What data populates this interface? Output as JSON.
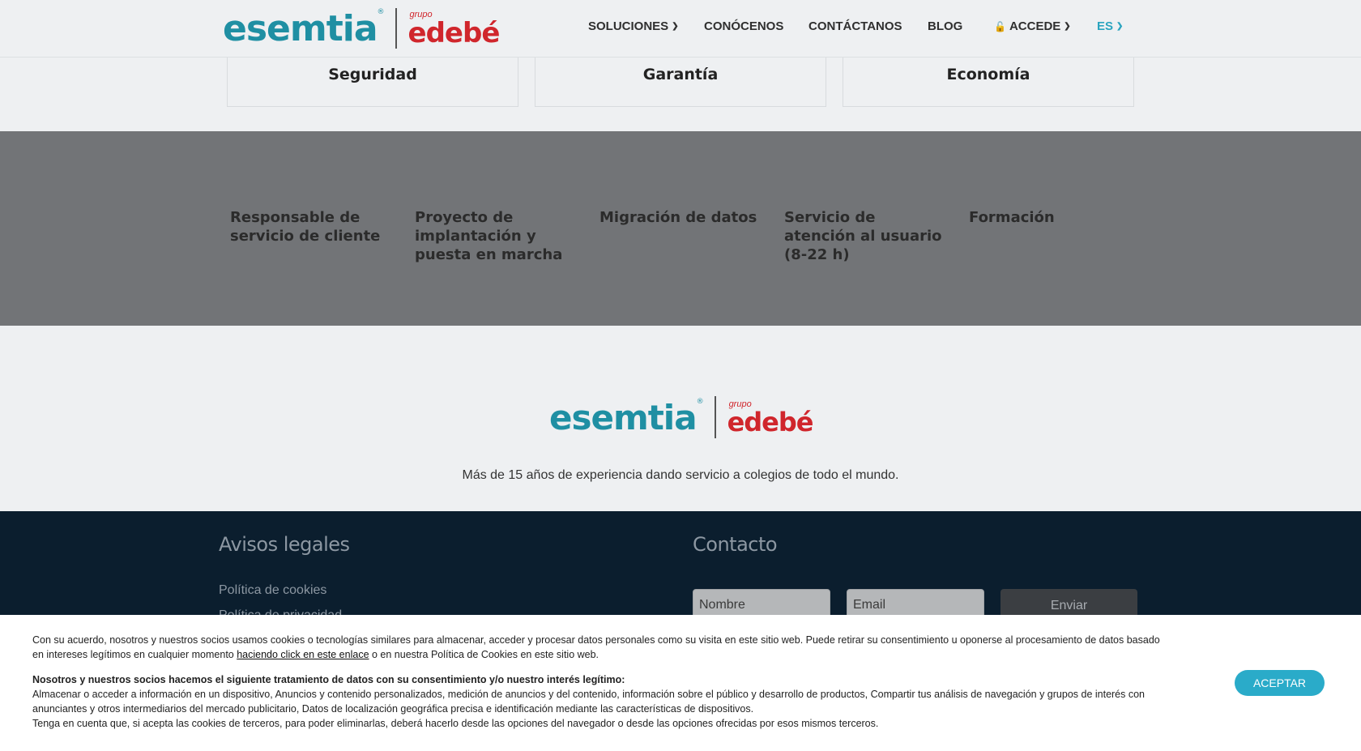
{
  "brand": {
    "name": "esemtia",
    "registered": "®",
    "group_prefix": "grupo",
    "group_name": "edebé",
    "primary_color": "#1f8fa3",
    "group_color": "#d0262c"
  },
  "nav": {
    "soluciones": "SOLUCIONES",
    "conocenos": "CONÓCENOS",
    "contactanos": "CONTÁCTANOS",
    "blog": "BLOG",
    "accede": "ACCEDE",
    "language": "ES",
    "chevron_icon": "chevron-down-icon",
    "lock_icon": "lock-icon"
  },
  "features": [
    "Seguridad",
    "Garantía",
    "Economía"
  ],
  "services": [
    "Responsable de servicio de cliente",
    "Proyecto de implantación y puesta en marcha",
    "Migración de datos",
    "Servicio de atención al usuario (8-22 h)",
    "Formación"
  ],
  "about": {
    "text": "Más de 15 años de experiencia dando servicio a colegios de todo el mundo."
  },
  "footer": {
    "legal_heading": "Avisos legales",
    "legal_links": [
      "Política de cookies",
      "Política de privacidad"
    ],
    "contact_heading": "Contacto",
    "name_placeholder": "Nombre",
    "email_placeholder": "Email",
    "send_label": "Enviar"
  },
  "cookie_banner": {
    "intro_before_link": "Con su acuerdo, nosotros y nuestros socios usamos cookies o tecnologías similares para almacenar, acceder y procesar datos personales como su visita en este sitio web. Puede retirar su consentimiento u oponerse al procesamiento de datos basado en intereses legítimos en cualquier momento ",
    "link_text": "haciendo click en este enlace",
    "intro_after_link": " o en nuestra Política de Cookies en este sitio web.",
    "purposes_heading": "Nosotros y nuestros socios hacemos el siguiente tratamiento de datos con su consentimiento y/o nuestro interés legítimo:",
    "purposes": "Almacenar o acceder a información en un dispositivo, Anuncios y contenido personalizados, medición de anuncios y del contenido, información sobre el público y desarrollo de productos, Compartir tus análisis de navegación y grupos de interés con anunciantes y otros intermediarios del mercado publicitario, Datos de localización geográfica precisa e identificación mediante las características de dispositivos.",
    "third_party_note": "Tenga en cuenta que, si acepta las cookies de terceros, para poder eliminarlas, deberá hacerlo desde las opciones del navegador o desde las opciones ofrecidas por esos mismos terceros.",
    "accept_label": "ACEPTAR",
    "accept_color": "#2aabc9"
  }
}
